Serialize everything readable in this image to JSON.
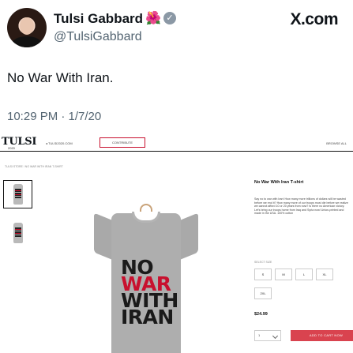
{
  "tweet": {
    "author_name": "Tulsi Gabbard",
    "author_emoji": "🌺",
    "verified_mark": "✓",
    "handle": "@TulsiGabbard",
    "source": "X.com",
    "text": "No War With Iran.",
    "timestamp": "10:29 PM · 1/7/20"
  },
  "store": {
    "logo": "TULSI",
    "logo_sub": "2020",
    "site_link": "◂ TULSI2020.COM",
    "contribute_label": "CONTRIBUTE",
    "browse_all_label": "BROWSE ALL",
    "breadcrumb": "TULSI STORE / NO WAR WITH IRAN T-SHIRT",
    "shirt_print": {
      "line1": "NO",
      "line2": "WAR",
      "line3": "WITH",
      "line4": "IRAN"
    },
    "product": {
      "title": "No War With Iran T-shirt",
      "description": "Say no to war with Iran! How many more trillions of dollars will be wasted before we end it? How many more of our troops must die before we realize we cannot afford 10 or 20 years from now? Is there no American victory. Let's bring our troops home from Iraq and Syria now! Union-printed and made in the USA. 100% cotton",
      "select_size_label": "SELECT SIZE",
      "sizes": [
        "S",
        "M",
        "L",
        "XL",
        "2XL"
      ],
      "price": "$24.99",
      "quantity": "1",
      "add_to_cart_label": "ADD TO CART NOW"
    }
  },
  "colors": {
    "accent_red": "#c8102e",
    "cart_button": "#d9434f",
    "shirt_gray": "#adadad",
    "handle_gray": "#536471"
  }
}
